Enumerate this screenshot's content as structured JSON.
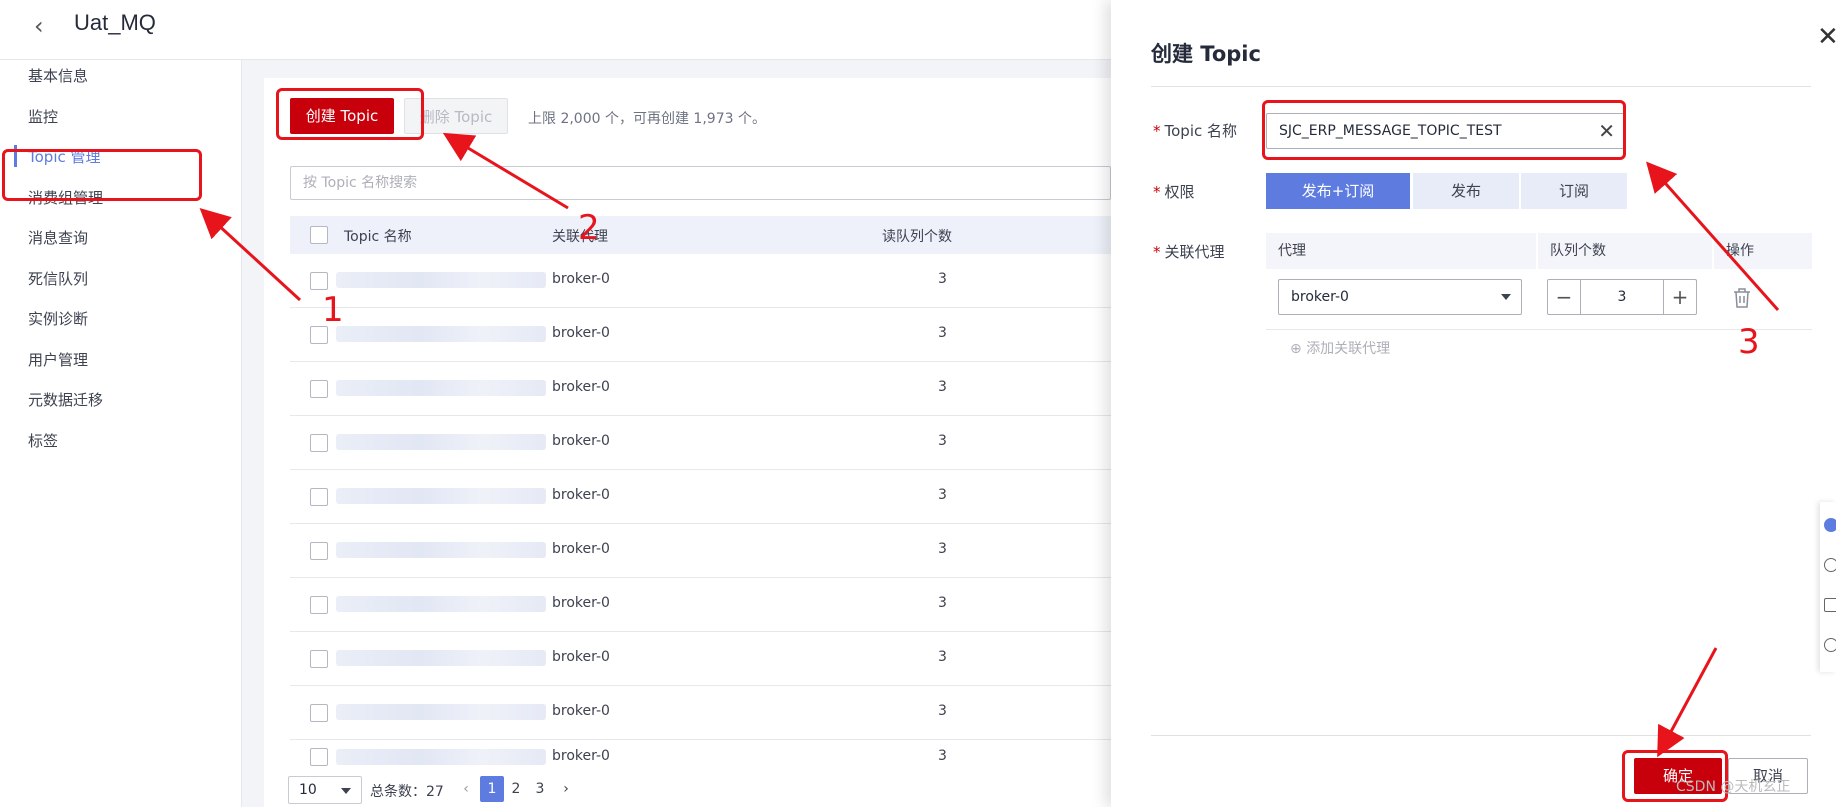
{
  "app": {
    "title": "Uat_MQ"
  },
  "sidebar": {
    "items": [
      {
        "label": "基本信息"
      },
      {
        "label": "监控"
      },
      {
        "label": "Topic 管理"
      },
      {
        "label": "消费组管理"
      },
      {
        "label": "消息查询"
      },
      {
        "label": "死信队列"
      },
      {
        "label": "实例诊断"
      },
      {
        "label": "用户管理"
      },
      {
        "label": "元数据迁移"
      },
      {
        "label": "标签"
      }
    ]
  },
  "toolbar": {
    "create_label": "创建 Topic",
    "delete_label": "删除 Topic",
    "limit_hint": "上限 2,000 个，可再创建 1,973 个。"
  },
  "search": {
    "placeholder": "按 Topic 名称搜索"
  },
  "table": {
    "columns": [
      "Topic 名称",
      "关联代理",
      "读队列个数"
    ],
    "rows": [
      {
        "broker": "broker-0",
        "read": "3"
      },
      {
        "broker": "broker-0",
        "read": "3"
      },
      {
        "broker": "broker-0",
        "read": "3"
      },
      {
        "broker": "broker-0",
        "read": "3"
      },
      {
        "broker": "broker-0",
        "read": "3"
      },
      {
        "broker": "broker-0",
        "read": "3"
      },
      {
        "broker": "broker-0",
        "read": "3"
      },
      {
        "broker": "broker-0",
        "read": "3"
      },
      {
        "broker": "broker-0",
        "read": "3"
      },
      {
        "broker": "broker-0",
        "read": "3"
      }
    ]
  },
  "pagination": {
    "page_size": "10",
    "total": "总条数：27",
    "pages": [
      "1",
      "2",
      "3"
    ],
    "current": "1"
  },
  "drawer": {
    "title": "创建 Topic",
    "topic_label": "Topic 名称",
    "topic_value": "SJC_ERP_MESSAGE_TOPIC_TEST",
    "perm_label": "权限",
    "perm_options": [
      "发布+订阅",
      "发布",
      "订阅"
    ],
    "broker_label": "关联代理",
    "broker_cols": [
      "代理",
      "队列个数",
      "操作"
    ],
    "broker_value": "broker-0",
    "queue_count": "3",
    "add_broker": "添加关联代理",
    "ok_label": "确定",
    "cancel_label": "取消"
  },
  "annotations": [
    "1",
    "2",
    "3"
  ],
  "watermark": "CSDN @天机玄正",
  "colors": {
    "accent": "#5e7ce0",
    "brand_red": "#c7000b",
    "annotation_red": "#e8141c"
  }
}
